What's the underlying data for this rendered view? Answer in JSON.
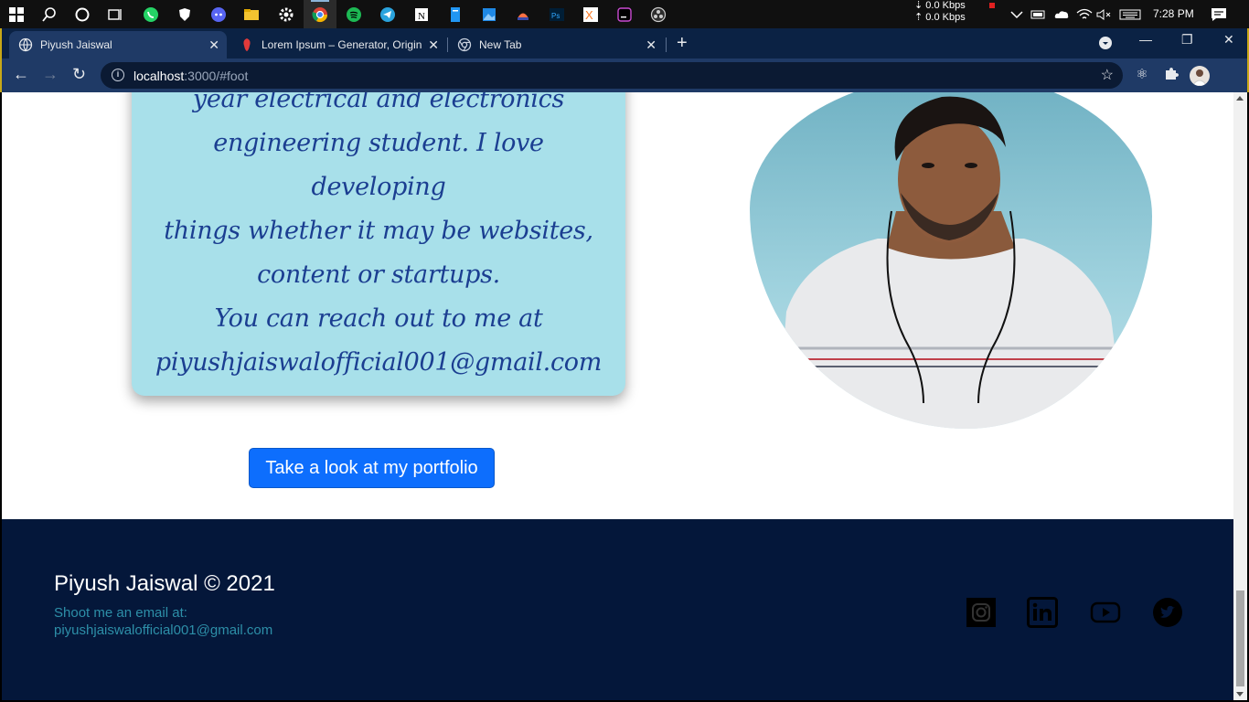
{
  "taskbar": {
    "net_down": "0.0 Kbps",
    "net_up": "0.0 Kbps",
    "clock": "7:28 PM"
  },
  "browser": {
    "tabs": [
      {
        "label": "Piyush Jaiswal"
      },
      {
        "label": "Lorem Ipsum – Generator, Origin"
      },
      {
        "label": "New Tab"
      }
    ],
    "url_host": "localhost",
    "url_path": ":3000/#foot"
  },
  "about": {
    "lines": [
      "year electrical and electronics",
      "engineering student. I love developing",
      "things whether it may be websites,",
      "content or startups.",
      "You can reach out to me at",
      "piyushjaiswalofficial001@gmail.com"
    ]
  },
  "cta": {
    "portfolio_label": "Take a look at my portfolio"
  },
  "footer": {
    "title": "Piyush Jaiswal © 2021",
    "email_prefix": "Shoot me an email at:",
    "email": "piyushjaiswalofficial001@gmail.com",
    "social": [
      "instagram-icon",
      "linkedin-icon",
      "youtube-icon",
      "twitter-icon"
    ]
  },
  "colors": {
    "card_bg": "#a8e0ea",
    "card_text": "#1b3e91",
    "button": "#0d6efd",
    "footer_bg": "#04173a",
    "footer_email": "#2d8fa8"
  }
}
